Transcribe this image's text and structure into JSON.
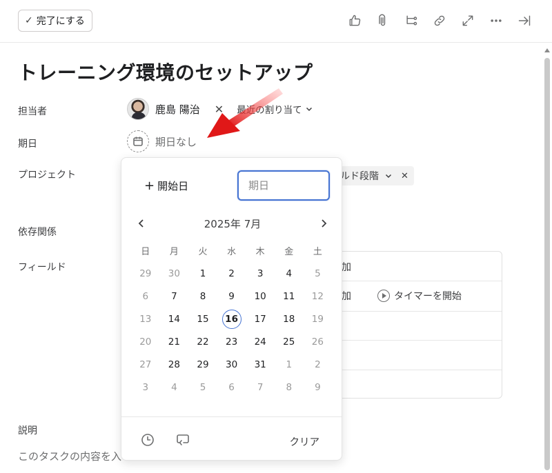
{
  "toolbar": {
    "complete_label": "完了にする",
    "icons": [
      "like-icon",
      "attachment-icon",
      "subtask-icon",
      "link-icon",
      "expand-icon",
      "more-icon",
      "close-pane-icon"
    ]
  },
  "task": {
    "title": "トレーニング環境のセットアップ"
  },
  "fields": {
    "assignee_label": "担当者",
    "assignee_name": "鹿島 陽治",
    "recent_assign": "最近の割り当て",
    "due_label": "期日",
    "due_value": "期日なし",
    "project_label": "プロジェクト",
    "project_tag": "ルド段階",
    "dependency_label": "依存関係",
    "custom_fields_label": "フィールド",
    "add_field_partial": "加",
    "timer_partial": "加",
    "timer_label": "タイマーを開始",
    "description_label": "説明",
    "description_placeholder": "このタスクの内容を入"
  },
  "calendar": {
    "start_date_label": "開始日",
    "due_input_placeholder": "期日",
    "month_label": "2025年 7月",
    "weekdays": [
      "日",
      "月",
      "火",
      "水",
      "木",
      "金",
      "土"
    ],
    "weeks": [
      [
        {
          "d": "29",
          "dim": true
        },
        {
          "d": "30",
          "dim": true
        },
        {
          "d": "1"
        },
        {
          "d": "2"
        },
        {
          "d": "3"
        },
        {
          "d": "4"
        },
        {
          "d": "5",
          "dim": true
        }
      ],
      [
        {
          "d": "6",
          "dim": true
        },
        {
          "d": "7"
        },
        {
          "d": "8"
        },
        {
          "d": "9"
        },
        {
          "d": "10"
        },
        {
          "d": "11"
        },
        {
          "d": "12",
          "dim": true
        }
      ],
      [
        {
          "d": "13",
          "dim": true
        },
        {
          "d": "14"
        },
        {
          "d": "15"
        },
        {
          "d": "16",
          "today": true
        },
        {
          "d": "17"
        },
        {
          "d": "18"
        },
        {
          "d": "19",
          "dim": true
        }
      ],
      [
        {
          "d": "20",
          "dim": true
        },
        {
          "d": "21"
        },
        {
          "d": "22"
        },
        {
          "d": "23"
        },
        {
          "d": "24"
        },
        {
          "d": "25"
        },
        {
          "d": "26",
          "dim": true
        }
      ],
      [
        {
          "d": "27",
          "dim": true
        },
        {
          "d": "28"
        },
        {
          "d": "29"
        },
        {
          "d": "30"
        },
        {
          "d": "31"
        },
        {
          "d": "1",
          "dim": true
        },
        {
          "d": "2",
          "dim": true
        }
      ],
      [
        {
          "d": "3",
          "dim": true
        },
        {
          "d": "4",
          "dim": true
        },
        {
          "d": "5",
          "dim": true
        },
        {
          "d": "6",
          "dim": true
        },
        {
          "d": "7",
          "dim": true
        },
        {
          "d": "8",
          "dim": true
        },
        {
          "d": "9",
          "dim": true
        }
      ]
    ],
    "clear_label": "クリア",
    "today_color": "#4573d2"
  },
  "colors": {
    "accent": "#4573d2",
    "annotation_arrow": "#e02020"
  }
}
